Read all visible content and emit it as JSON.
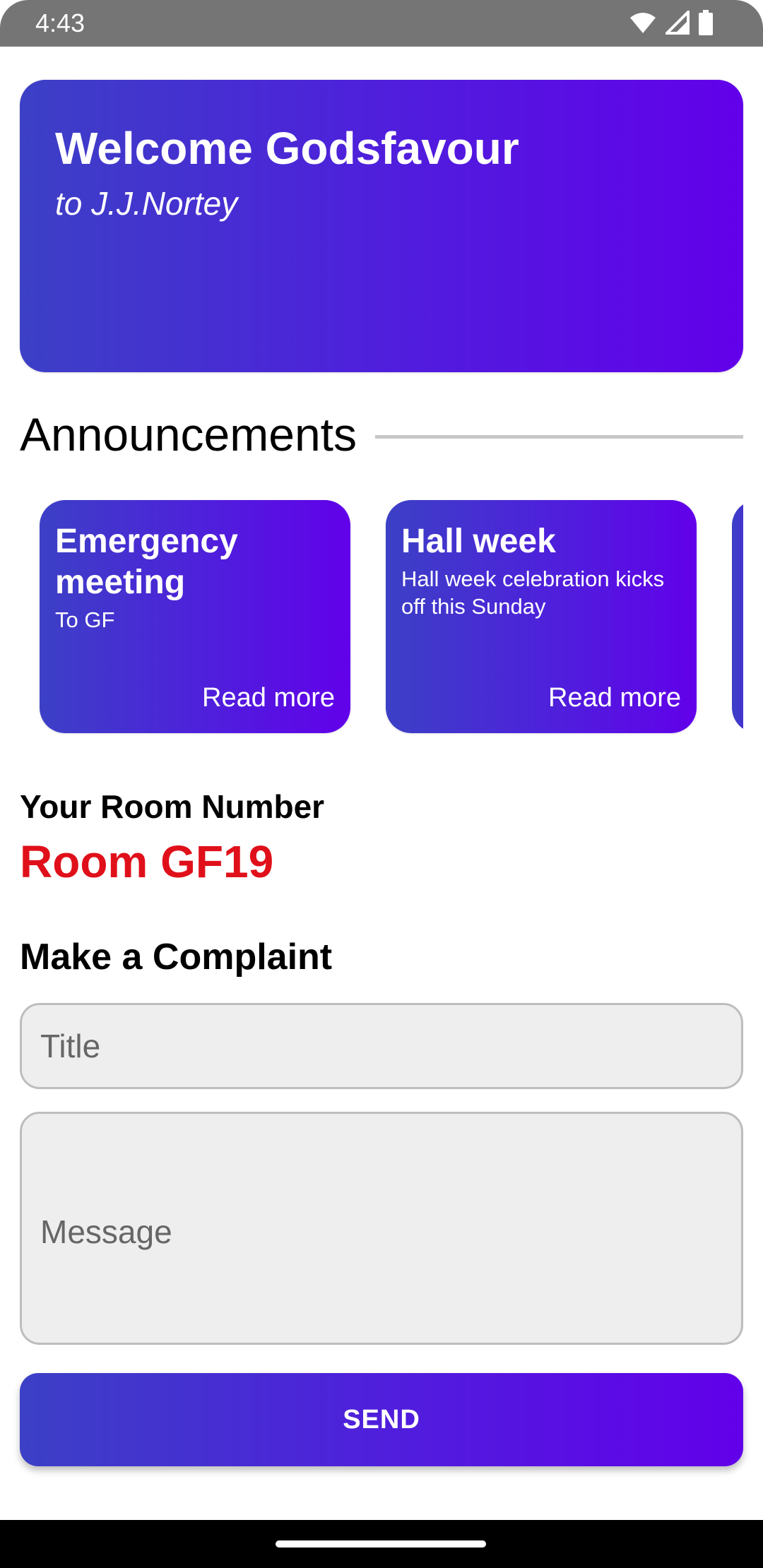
{
  "status_bar": {
    "time": "4:43",
    "icons": [
      "wifi-icon",
      "cell-signal-icon",
      "battery-icon"
    ]
  },
  "welcome": {
    "title": "Welcome Godsfavour",
    "subtitle": "to J.J.Nortey"
  },
  "announcements": {
    "heading": "Announcements",
    "items": [
      {
        "title": "Emergency meeting",
        "body": "To GF",
        "link": "Read more"
      },
      {
        "title": "Hall week",
        "body": "Hall week celebration kicks off this Sunday",
        "link": "Read more"
      }
    ]
  },
  "room": {
    "label": "Your Room Number",
    "value": "Room GF19"
  },
  "complaint": {
    "heading": "Make a Complaint",
    "title_placeholder": "Title",
    "message_placeholder": "Message",
    "send_label": "SEND"
  },
  "colors": {
    "gradient_start": "#3c40c6",
    "gradient_end": "#6200ea",
    "room_value": "#e0101a"
  }
}
